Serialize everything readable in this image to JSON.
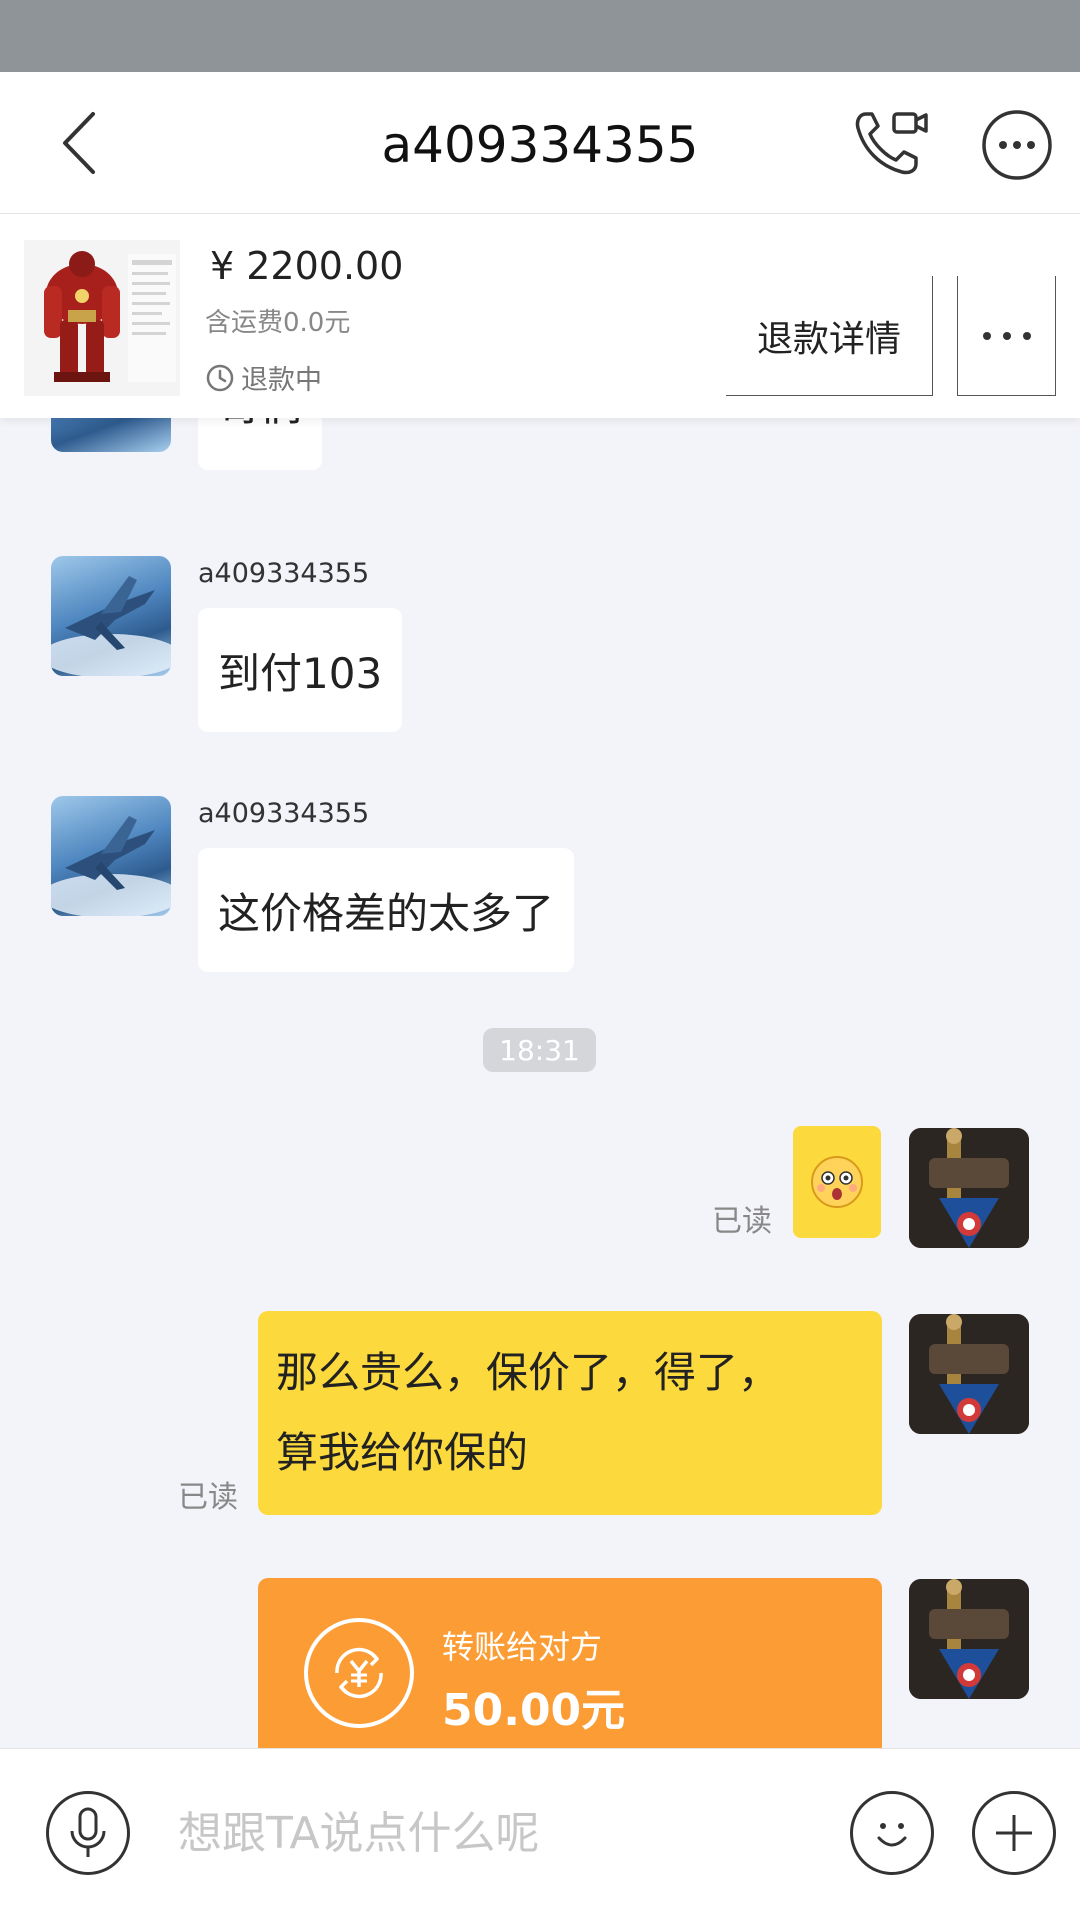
{
  "header": {
    "title": "a409334355",
    "back_icon": "chevron-left-icon",
    "call_icon": "phone-video-icon",
    "more_icon": "ellipsis-circle-icon"
  },
  "order": {
    "price": "¥ 2200.00",
    "shipping": "含运费0.0元",
    "status": "退款中",
    "refund_button": "退款详情",
    "status_icon": "clock-icon",
    "more_icon": "ellipsis-icon"
  },
  "chat": {
    "partial_message": "哥们",
    "messages": [
      {
        "sender": "a409334355",
        "text": "到付103"
      },
      {
        "sender": "a409334355",
        "text": "这价格差的太多了"
      }
    ],
    "time_divider": "18:31",
    "my_messages": [
      {
        "type": "emoji",
        "read": "已读",
        "emoji_icon": "surprised-face-icon"
      },
      {
        "type": "text",
        "read": "已读",
        "line1": "那么贵么，保价了，得了，",
        "line2": "算我给你保的"
      }
    ],
    "transfer": {
      "label": "转账给对方",
      "amount": "50.00元",
      "icon": "yuan-transfer-icon"
    }
  },
  "input_bar": {
    "placeholder": "想跟TA说点什么呢",
    "voice_icon": "microphone-icon",
    "emoji_icon": "smiley-icon",
    "plus_icon": "plus-icon"
  },
  "colors": {
    "status_bar": "#8e9498",
    "my_bubble": "#fcd93c",
    "transfer": "#fc9c34",
    "chat_bg": "#f3f4f9"
  }
}
